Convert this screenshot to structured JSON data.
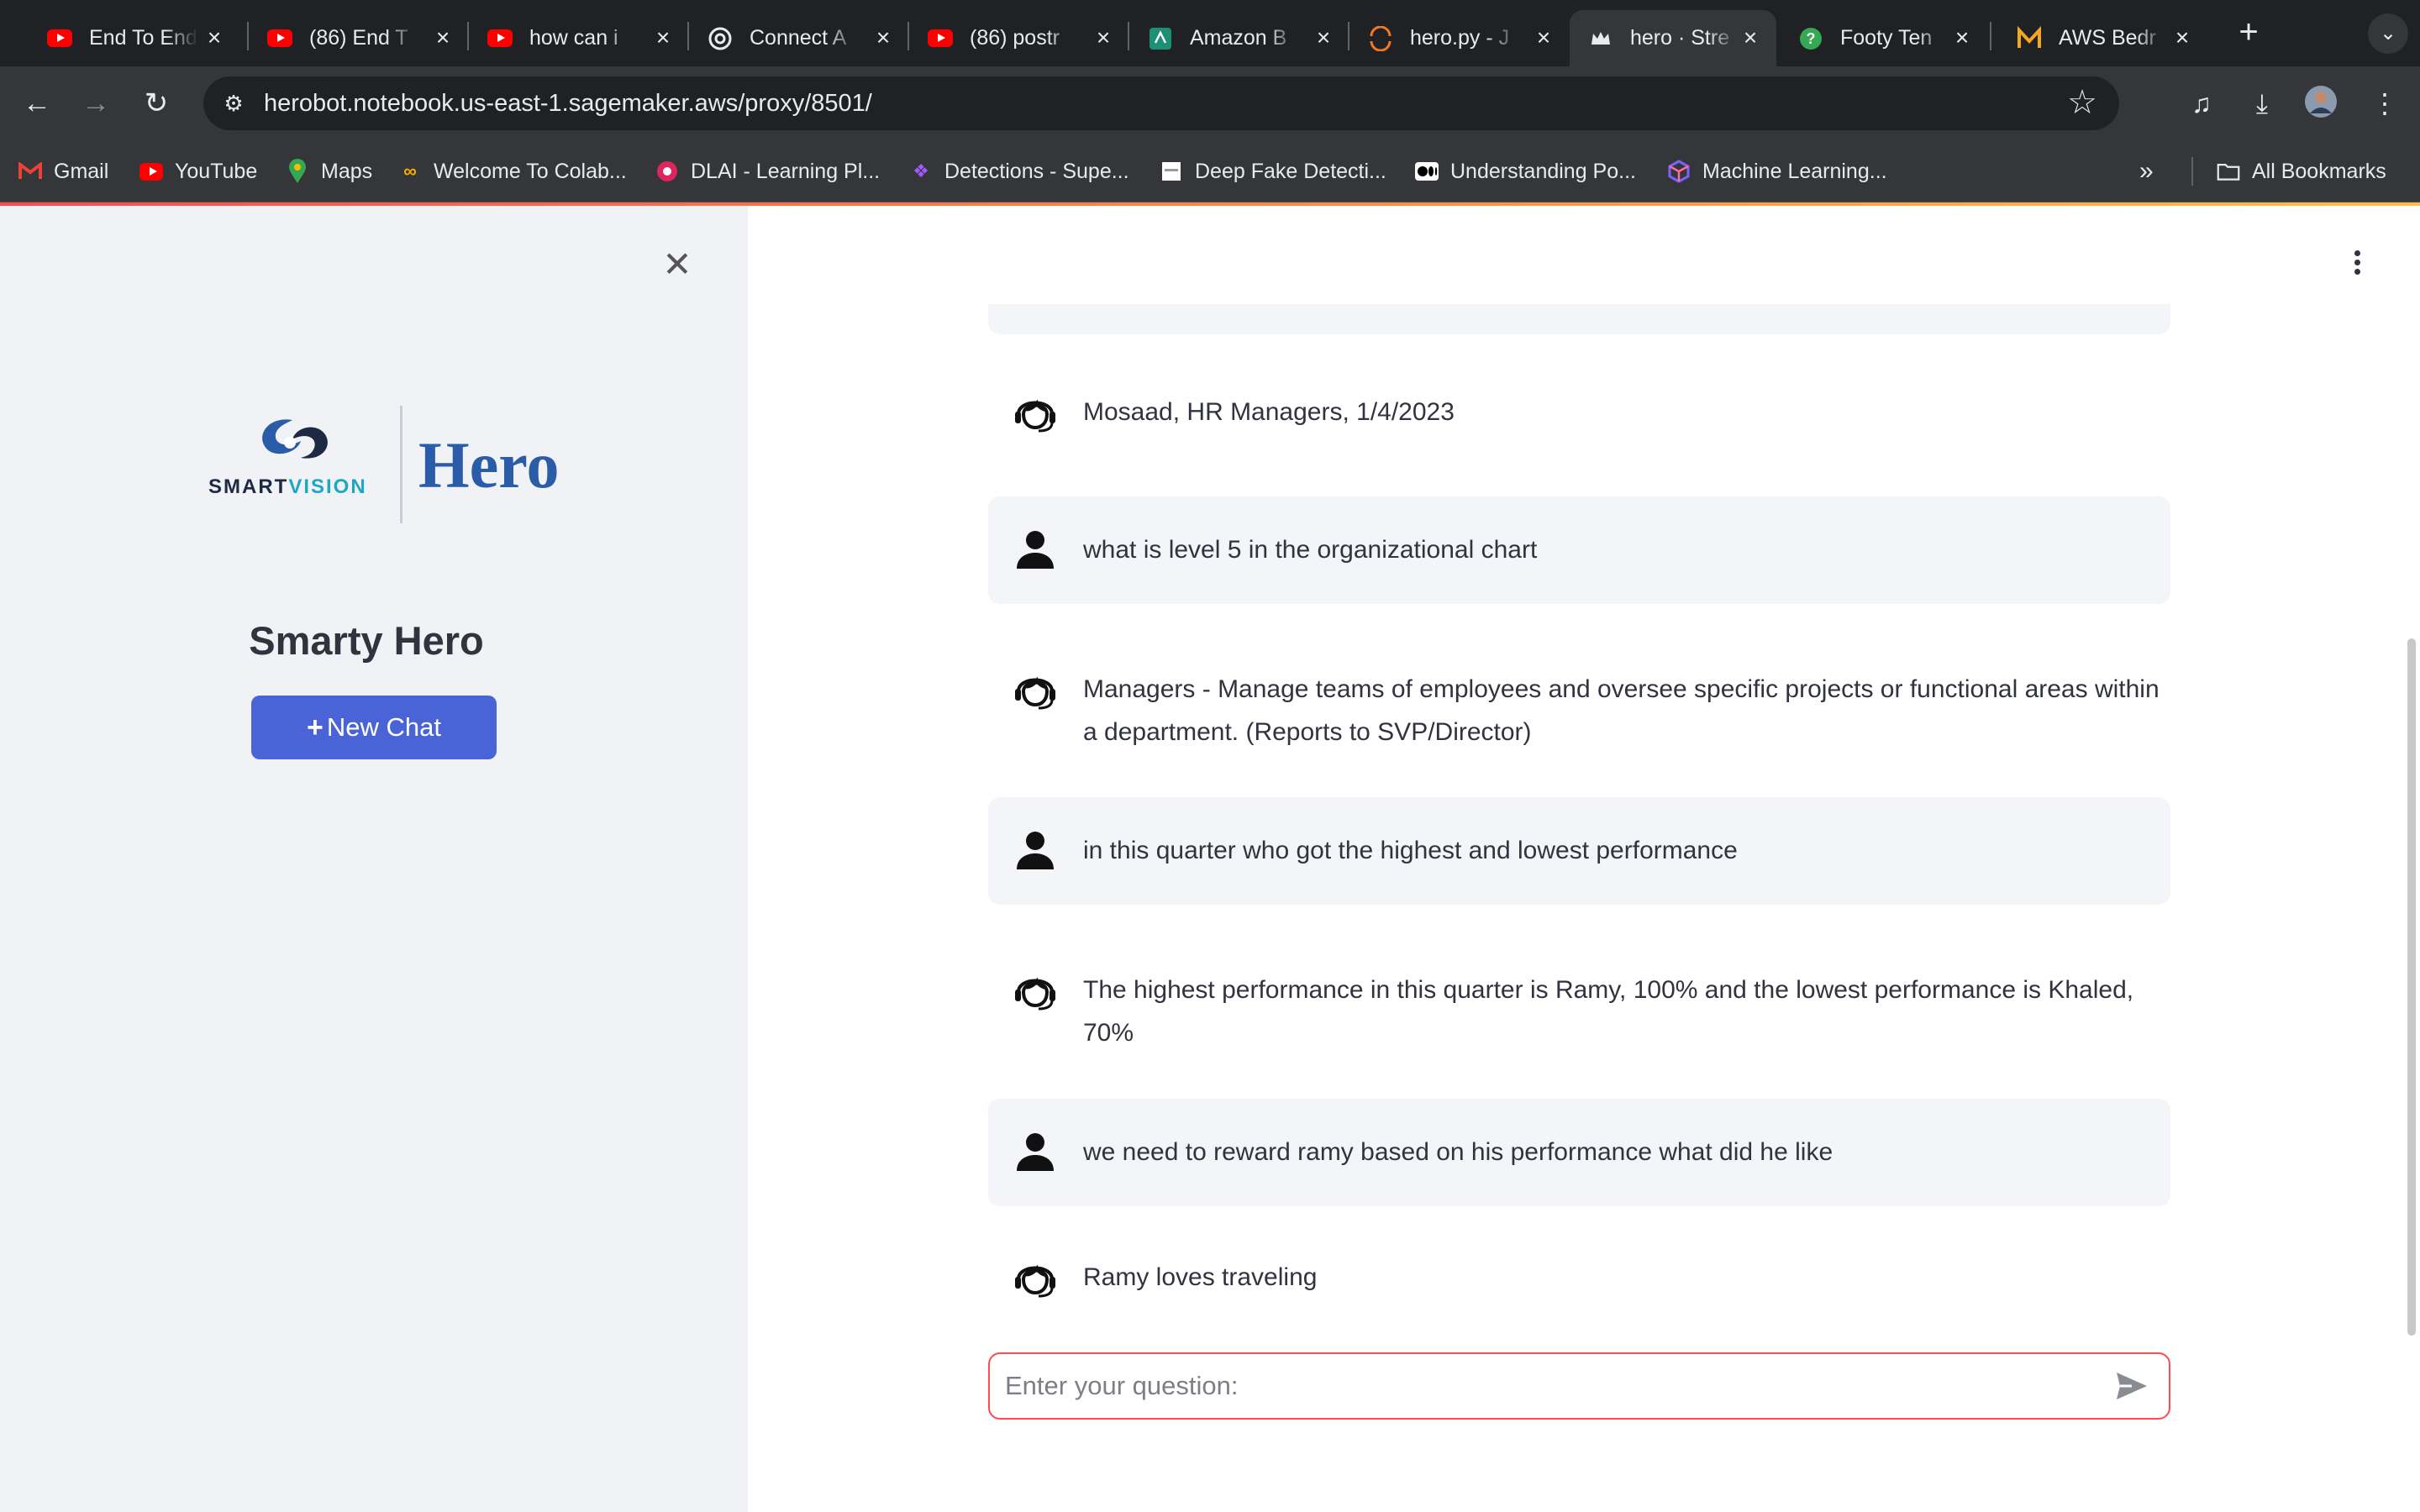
{
  "browser": {
    "tabs": [
      {
        "title": "End To End",
        "favicon": "youtube-icon",
        "active": false
      },
      {
        "title": "(86) End T",
        "favicon": "youtube-icon",
        "active": false
      },
      {
        "title": "how can i",
        "favicon": "youtube-icon",
        "active": false
      },
      {
        "title": "Connect A",
        "favicon": "openai-icon",
        "active": false
      },
      {
        "title": "(86) postr",
        "favicon": "youtube-icon",
        "active": false
      },
      {
        "title": "Amazon B",
        "favicon": "aws-bedrock-icon",
        "active": false
      },
      {
        "title": "hero.py - J",
        "favicon": "jupyter-icon",
        "active": false
      },
      {
        "title": "hero · Stre",
        "favicon": "streamlit-crown-icon",
        "active": true
      },
      {
        "title": "Footy Ten",
        "favicon": "help-icon",
        "active": false
      },
      {
        "title": "AWS Bedr",
        "favicon": "medium-icon",
        "active": false
      }
    ],
    "url": "herobot.notebook.us-east-1.sagemaker.aws/proxy/8501/",
    "bookmarks": [
      {
        "label": "Gmail",
        "icon": "gmail-icon"
      },
      {
        "label": "YouTube",
        "icon": "youtube-icon"
      },
      {
        "label": "Maps",
        "icon": "maps-icon"
      },
      {
        "label": "Welcome To Colab...",
        "icon": "colab-icon"
      },
      {
        "label": "DLAI - Learning Pl...",
        "icon": "dlai-icon"
      },
      {
        "label": "Detections - Supe...",
        "icon": "supervision-icon"
      },
      {
        "label": "Deep Fake Detecti...",
        "icon": "page-icon"
      },
      {
        "label": "Understanding Po...",
        "icon": "medium-icon"
      },
      {
        "label": "Machine Learning...",
        "icon": "cube-icon"
      }
    ],
    "all_bookmarks_label": "All Bookmarks"
  },
  "sidebar": {
    "logo": {
      "brand": "SMARTVISION",
      "brand_part1": "SMART",
      "brand_part2": "VISION",
      "product": "Hero"
    },
    "title": "Smarty Hero",
    "new_chat_label": "New Chat"
  },
  "chat": {
    "messages": [
      {
        "role": "assistant",
        "text": "Mosaad, HR Managers, 1/4/2023"
      },
      {
        "role": "user",
        "text": "what is level 5 in the organizational chart"
      },
      {
        "role": "assistant",
        "text": "Managers - Manage teams of employees and oversee specific projects or functional areas within a department. (Reports to SVP/Director)"
      },
      {
        "role": "user",
        "text": "in this quarter who got the highest and lowest performance"
      },
      {
        "role": "assistant",
        "text": "The highest performance in this quarter is Ramy, 100% and the lowest performance is Khaled, 70%"
      },
      {
        "role": "user",
        "text": "we need to reward ramy based on his performance what did he like"
      },
      {
        "role": "assistant",
        "text": "Ramy loves traveling"
      }
    ],
    "input_placeholder": "Enter your question:"
  },
  "colors": {
    "accent": "#4a64d8",
    "input_border": "#ff4b4b",
    "sidebar_bg": "#f0f2f6",
    "user_bubble": "#f4f5f8",
    "brand_blue": "#2a5ca8"
  }
}
